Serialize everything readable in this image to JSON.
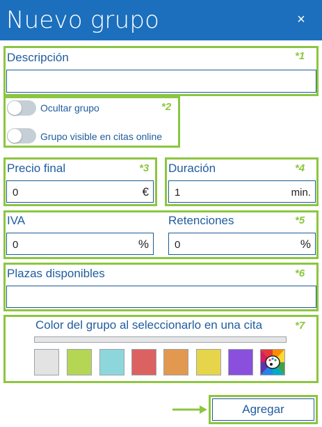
{
  "dialog": {
    "title": "Nuevo grupo",
    "close_symbol": "×"
  },
  "marks": [
    "*1",
    "*2",
    "*3",
    "*4",
    "*5",
    "*6",
    "*7"
  ],
  "descripcion": {
    "label": "Descripción",
    "value": ""
  },
  "toggles": [
    {
      "label": "Ocultar grupo",
      "on": false
    },
    {
      "label": "Grupo visible en citas online",
      "on": false
    }
  ],
  "precio": {
    "label": "Precio final",
    "value": "0",
    "unit": "€"
  },
  "duracion": {
    "label": "Duración",
    "value": "1",
    "unit": "min."
  },
  "iva": {
    "label": "IVA",
    "value": "0",
    "unit": "%"
  },
  "retenciones": {
    "label": "Retenciones",
    "value": "0",
    "unit": "%"
  },
  "plazas": {
    "label": "Plazas disponibles",
    "value": ""
  },
  "color": {
    "label": "Color del grupo al seleccionarlo en una cita",
    "swatches": [
      "#e3e3e3",
      "#b5d654",
      "#8dd7dc",
      "#dc6262",
      "#e39850",
      "#e6d54a",
      "#8a4fdc"
    ],
    "palette_icon": "palette-icon"
  },
  "actions": {
    "add_label": "Agregar",
    "arrow_icon": "arrow-right-icon"
  },
  "colors": {
    "header": "#1b6fbd",
    "highlight": "#8cc63f",
    "label": "#1f5c9e"
  }
}
